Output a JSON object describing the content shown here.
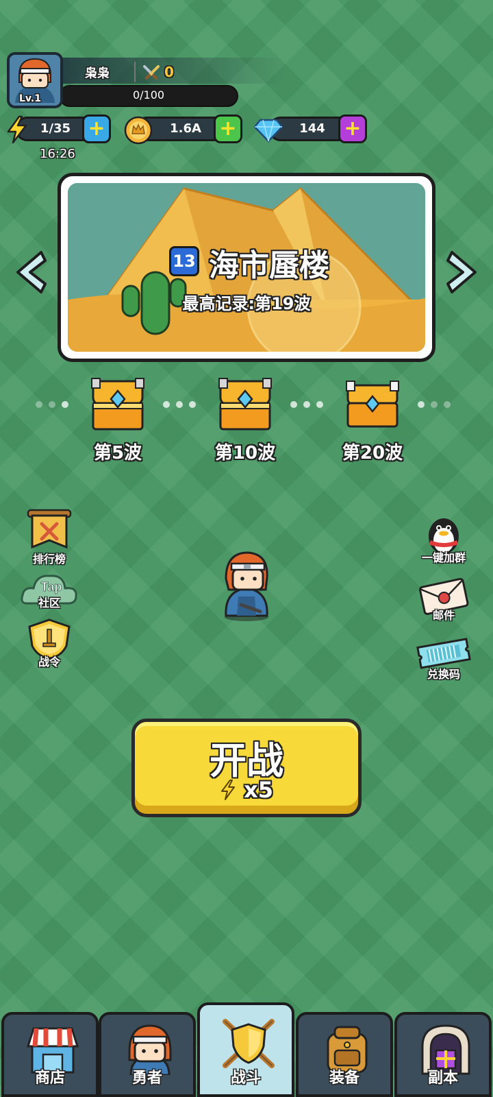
{
  "player": {
    "name": "枭枭",
    "level": "Lv.1",
    "power": "0",
    "xp": "0/100",
    "avatar_icon": "ninja-hero-icon"
  },
  "currencies": {
    "energy": "1/35",
    "energy_timer": "16:26",
    "gold": "1.6A",
    "diamonds": "144",
    "plus_label": "+"
  },
  "stage": {
    "number": "13",
    "name": "海市蜃楼",
    "record": "最高记录:第19波"
  },
  "waves": [
    {
      "label": "第5波"
    },
    {
      "label": "第10波"
    },
    {
      "label": "第20波"
    }
  ],
  "left_menu": {
    "ranking": "排行榜",
    "community_badge": "Tap",
    "community": "社区",
    "battle_pass": "战令"
  },
  "right_menu": {
    "join_group": "一键加群",
    "mail": "邮件",
    "redeem": "兑换码"
  },
  "battle_button": {
    "title": "开战",
    "cost": "x5"
  },
  "nav": [
    {
      "label": "商店",
      "icon": "shop-icon"
    },
    {
      "label": "勇者",
      "icon": "hero-icon"
    },
    {
      "label": "战斗",
      "icon": "battle-shield-icon"
    },
    {
      "label": "装备",
      "icon": "backpack-icon"
    },
    {
      "label": "副本",
      "icon": "dungeon-gate-icon"
    }
  ],
  "colors": {
    "background": "#4a9a66",
    "gold_accent": "#f5c93a",
    "battle_button": "#f7d93a",
    "active_tab": "#bfe3ea"
  }
}
